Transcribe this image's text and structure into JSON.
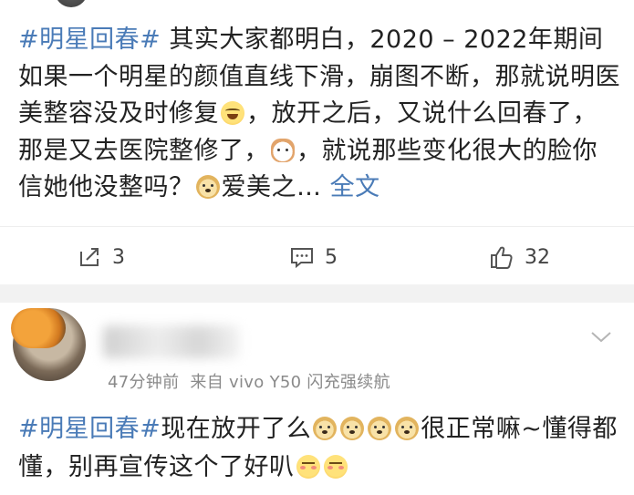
{
  "post": {
    "topic": "#明星回春#",
    "text_part1": " 其实大家都明白，2020 – 2022年期间如果一个明星的颜值直线下滑，崩图不断，那就说明医美整容没及时修复",
    "text_part2": "，放开之后，又说什么回春了，那是又去医院整修了，",
    "text_part3": "，就说那些变化很大的脸你信她他没整吗？",
    "text_part4": "爱美之…",
    "more_link": "全文",
    "emoji_1": "laugh-cry-emoji",
    "emoji_2": "cat-emoji",
    "emoji_3": "doge-emoji"
  },
  "actions": {
    "repost_count": "3",
    "comment_count": "5",
    "like_count": "32"
  },
  "comment": {
    "meta_time": "47分钟前",
    "meta_source": "来自 vivo Y50 闪充强续航",
    "topic": "#明星回春#",
    "text_part1": "现在放开了么",
    "text_part2": "很正常嘛~懂得都懂，别再宣传这个了好叭",
    "emoji_doge": "doge-emoji",
    "emoji_shy": "shy-emoji"
  },
  "colors": {
    "link": "#4a7bb7",
    "text": "#222222",
    "meta": "#8a8a8a",
    "separator": "#f2f2f2"
  }
}
